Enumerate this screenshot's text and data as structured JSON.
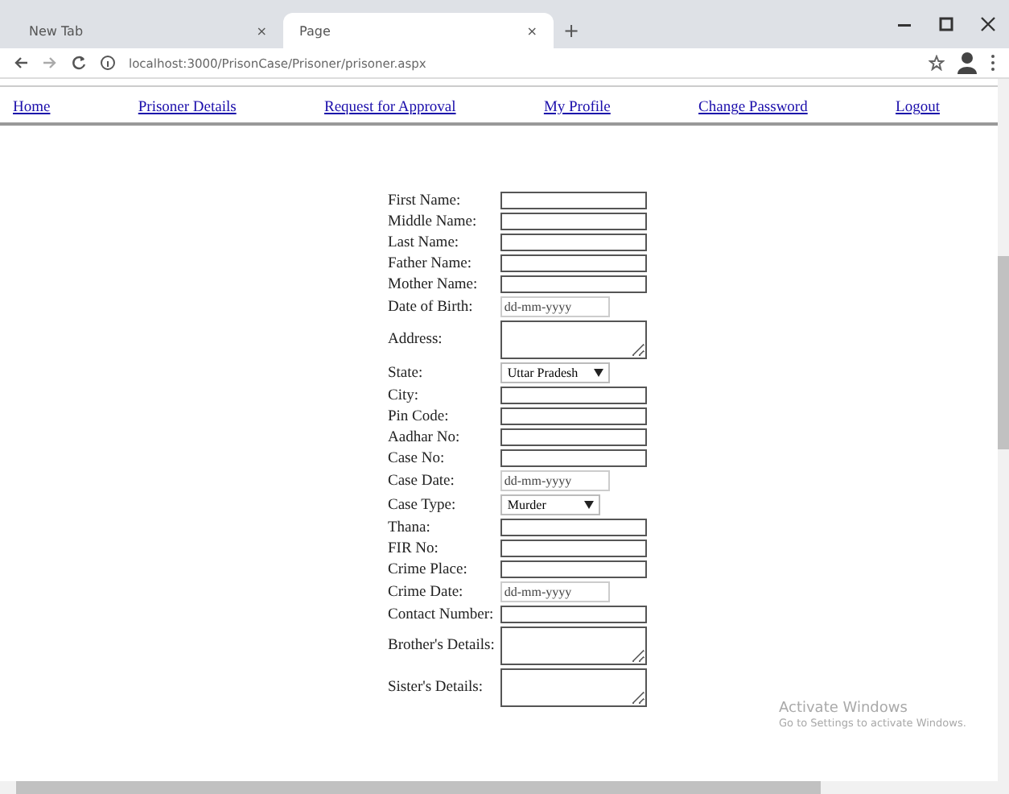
{
  "browser": {
    "tabs": [
      {
        "title": "New Tab",
        "selected": false,
        "close": "×"
      },
      {
        "title": "Page",
        "selected": true,
        "close": "×"
      }
    ],
    "new_tab": "+",
    "url": "localhost:3000/PrisonCase/Prisoner/prisoner.aspx"
  },
  "nav": [
    "Home",
    "Prisoner Details",
    "Request for Approval",
    "My Profile",
    "Change Password",
    "Logout"
  ],
  "fields": [
    {
      "label": "First Name:",
      "kind": "text"
    },
    {
      "label": "Middle Name:",
      "kind": "text"
    },
    {
      "label": "Last Name:",
      "kind": "text"
    },
    {
      "label": "Father Name:",
      "kind": "text"
    },
    {
      "label": "Mother Name:",
      "kind": "text"
    },
    {
      "label": "Date of Birth:",
      "kind": "date",
      "value": "dd-mm-yyyy"
    },
    {
      "label": "Address:",
      "kind": "textarea"
    },
    {
      "label": "State:",
      "kind": "select",
      "value": "Uttar Pradesh"
    },
    {
      "label": "City:",
      "kind": "text"
    },
    {
      "label": "Pin Code:",
      "kind": "text"
    },
    {
      "label": "Aadhar No:",
      "kind": "text"
    },
    {
      "label": "Case No:",
      "kind": "text"
    },
    {
      "label": "Case Date:",
      "kind": "date",
      "value": "dd-mm-yyyy"
    },
    {
      "label": "Case Type:",
      "kind": "select",
      "value": "Murder"
    },
    {
      "label": "Thana:",
      "kind": "text"
    },
    {
      "label": "FIR No:",
      "kind": "text"
    },
    {
      "label": "Crime Place:",
      "kind": "text"
    },
    {
      "label": "Crime Date:",
      "kind": "date",
      "value": "dd-mm-yyyy"
    },
    {
      "label": "Contact Number:",
      "kind": "text"
    },
    {
      "label": "Brother's Details:",
      "kind": "textarea"
    },
    {
      "label": "Sister's Details:",
      "kind": "textarea"
    }
  ],
  "activation": {
    "title": "Activate Windows",
    "subtitle": "Go to Settings to activate Windows."
  }
}
